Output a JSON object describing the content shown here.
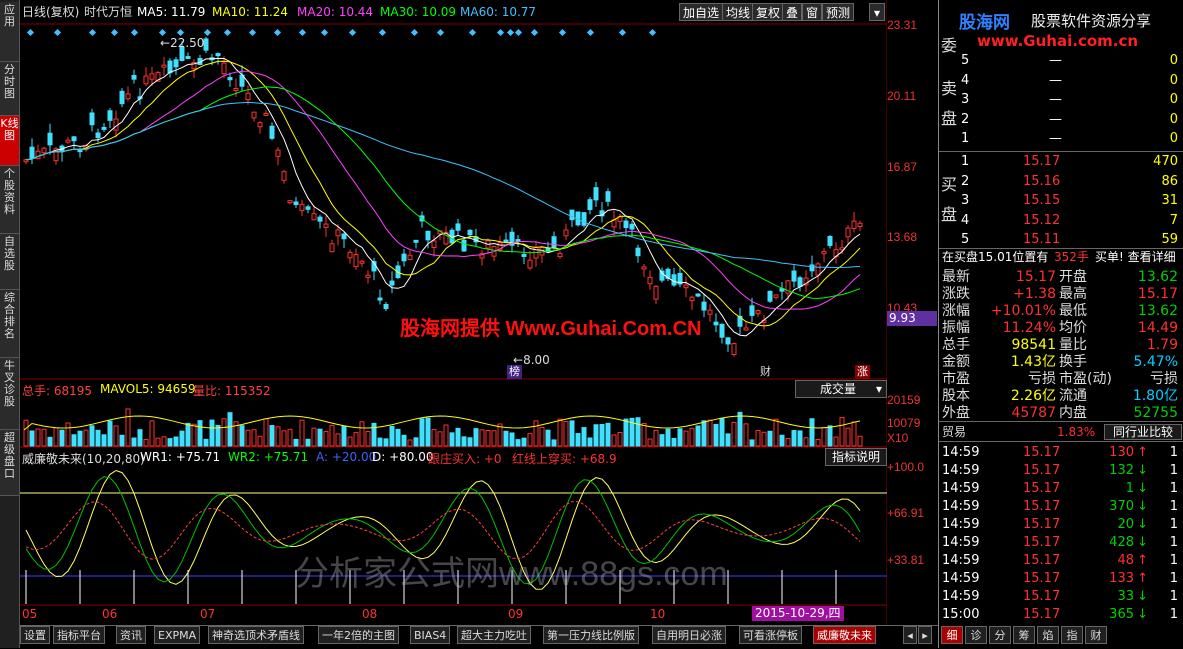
{
  "sidebar": {
    "items": [
      {
        "label": "应用"
      },
      {
        "label": "分时图"
      },
      {
        "label": "K线图"
      },
      {
        "label": "个股资料"
      },
      {
        "label": "自选股"
      },
      {
        "label": "综合排名"
      },
      {
        "label": "牛叉诊股"
      },
      {
        "label": "超级盘口"
      }
    ]
  },
  "main_header": {
    "period": "日线(复权)",
    "mode": "时代万恒",
    "ma5": "MA5: 11.79",
    "ma10": "MA10: 11.24",
    "ma20": "MA20: 10.44",
    "ma30": "MA30: 10.09",
    "ma60": "MA60: 10.77",
    "ma5_color": "#ffffff",
    "ma10_color": "#ffff00",
    "ma20_color": "#ff40ff",
    "ma30_color": "#00ff00",
    "ma60_color": "#40c0ff",
    "buttons": [
      "加自选",
      "均线",
      "复权",
      "叠",
      "窗",
      "预测"
    ]
  },
  "price_axis": [
    "23.31",
    "20.11",
    "16.87",
    "13.68",
    "10.43"
  ],
  "current_price_tag": "9.93",
  "high_label": "22.50",
  "low_label": "8.00",
  "markers": {
    "bang": "榜",
    "cai": "财",
    "zhang": "涨"
  },
  "watermarks": {
    "logo_cn": "股海网",
    "logo_tagline": "股票软件资源分享",
    "logo_url": "www.Guhai.com.cn",
    "center_text": "股海网提供 Www.Guhai.Com.CN",
    "bottom_text": "分析家公式网www.88gs.com"
  },
  "volume_panel": {
    "total": "总手: 68195",
    "mavol": "MAVOL5: 94659",
    "ratio": "量比: 115352",
    "dropdown": "成交量",
    "axis": [
      "20159",
      "10079",
      "X10"
    ]
  },
  "indicator_panel": {
    "name": "威廉敬未来(10,20,80)",
    "wr1": "WR1: +75.71",
    "wr2": "WR2: +75.71",
    "a": "A: +20.00",
    "d": "D: +80.00",
    "buy": "跟庄买入: +0",
    "redline": "红线上穿买: +68.9",
    "explain_button": "指标说明",
    "axis": [
      "+100.0",
      "+66.91",
      "+33.81"
    ]
  },
  "date_axis": {
    "months": [
      "05",
      "06",
      "07",
      "08",
      "09",
      "10"
    ],
    "current": "2015-10-29,四"
  },
  "bottom_tabs": [
    "设置",
    "指标平台",
    "资讯",
    "EXPMA",
    "神奇选顶术矛盾线",
    "一年2倍的主图",
    "BIAS4",
    "超大主力吃吐",
    "第一压力线比例版",
    "自用明日必涨",
    "可看涨停板",
    "威廉敬未来"
  ],
  "right_tabs": [
    "细",
    "诊",
    "分",
    "筹",
    "焰",
    "指",
    "财"
  ],
  "order_book": {
    "sell_title": "委",
    "sell_label": "卖盘",
    "buy_label": "买盘",
    "sells": [
      {
        "level": "5",
        "price": "—",
        "vol": "0"
      },
      {
        "level": "4",
        "price": "—",
        "vol": "0"
      },
      {
        "level": "3",
        "price": "—",
        "vol": "0"
      },
      {
        "level": "2",
        "price": "—",
        "vol": "0"
      },
      {
        "level": "1",
        "price": "—",
        "vol": "0"
      }
    ],
    "buys": [
      {
        "level": "1",
        "price": "15.17",
        "vol": "470"
      },
      {
        "level": "2",
        "price": "15.16",
        "vol": "86"
      },
      {
        "level": "3",
        "price": "15.15",
        "vol": "31"
      },
      {
        "level": "4",
        "price": "15.12",
        "vol": "7"
      },
      {
        "level": "5",
        "price": "15.11",
        "vol": "59"
      }
    ],
    "status_left": "在买盘15.01位置有",
    "status_vol": "352手",
    "status_right": "买单! 查看详细"
  },
  "quote": [
    {
      "k1": "最新",
      "v1": "15.17",
      "k2": "开盘",
      "v2": "13.62"
    },
    {
      "k1": "涨跌",
      "v1": "+1.38",
      "k2": "最高",
      "v2": "15.17"
    },
    {
      "k1": "涨幅",
      "v1": "+10.01%",
      "k2": "最低",
      "v2": "13.62"
    },
    {
      "k1": "振幅",
      "v1": "11.24%",
      "k2": "均价",
      "v2": "14.49"
    },
    {
      "k1": "总手",
      "v1": "98541",
      "k2": "量比",
      "v2": "1.79"
    },
    {
      "k1": "金额",
      "v1": "1.43亿",
      "k2": "换手",
      "v2": "5.47%"
    },
    {
      "k1": "市盈",
      "v1": "亏损",
      "k2": "市盈(动)",
      "v2": "亏损"
    },
    {
      "k1": "股本",
      "v1": "2.26亿",
      "k2": "流通",
      "v2": "1.80亿"
    },
    {
      "k1": "外盘",
      "v1": "45787",
      "k2": "内盘",
      "v2": "52755"
    }
  ],
  "industry": {
    "label": "贸易",
    "value": "1.83%",
    "button": "同行业比较"
  },
  "ticks": [
    {
      "time": "14:59",
      "price": "15.17",
      "vol": "130",
      "dir": "up",
      "n": "1"
    },
    {
      "time": "14:59",
      "price": "15.17",
      "vol": "132",
      "dir": "down",
      "n": "1"
    },
    {
      "time": "14:59",
      "price": "15.17",
      "vol": "1",
      "dir": "down",
      "n": "1"
    },
    {
      "time": "14:59",
      "price": "15.17",
      "vol": "370",
      "dir": "down",
      "n": "1"
    },
    {
      "time": "14:59",
      "price": "15.17",
      "vol": "20",
      "dir": "down",
      "n": "1"
    },
    {
      "time": "14:59",
      "price": "15.17",
      "vol": "428",
      "dir": "down",
      "n": "1"
    },
    {
      "time": "14:59",
      "price": "15.17",
      "vol": "48",
      "dir": "up",
      "n": "1"
    },
    {
      "time": "14:59",
      "price": "15.17",
      "vol": "133",
      "dir": "up",
      "n": "1"
    },
    {
      "time": "14:59",
      "price": "15.17",
      "vol": "33",
      "dir": "down",
      "n": "1"
    },
    {
      "time": "15:00",
      "price": "15.17",
      "vol": "365",
      "dir": "down",
      "n": "1"
    }
  ]
}
